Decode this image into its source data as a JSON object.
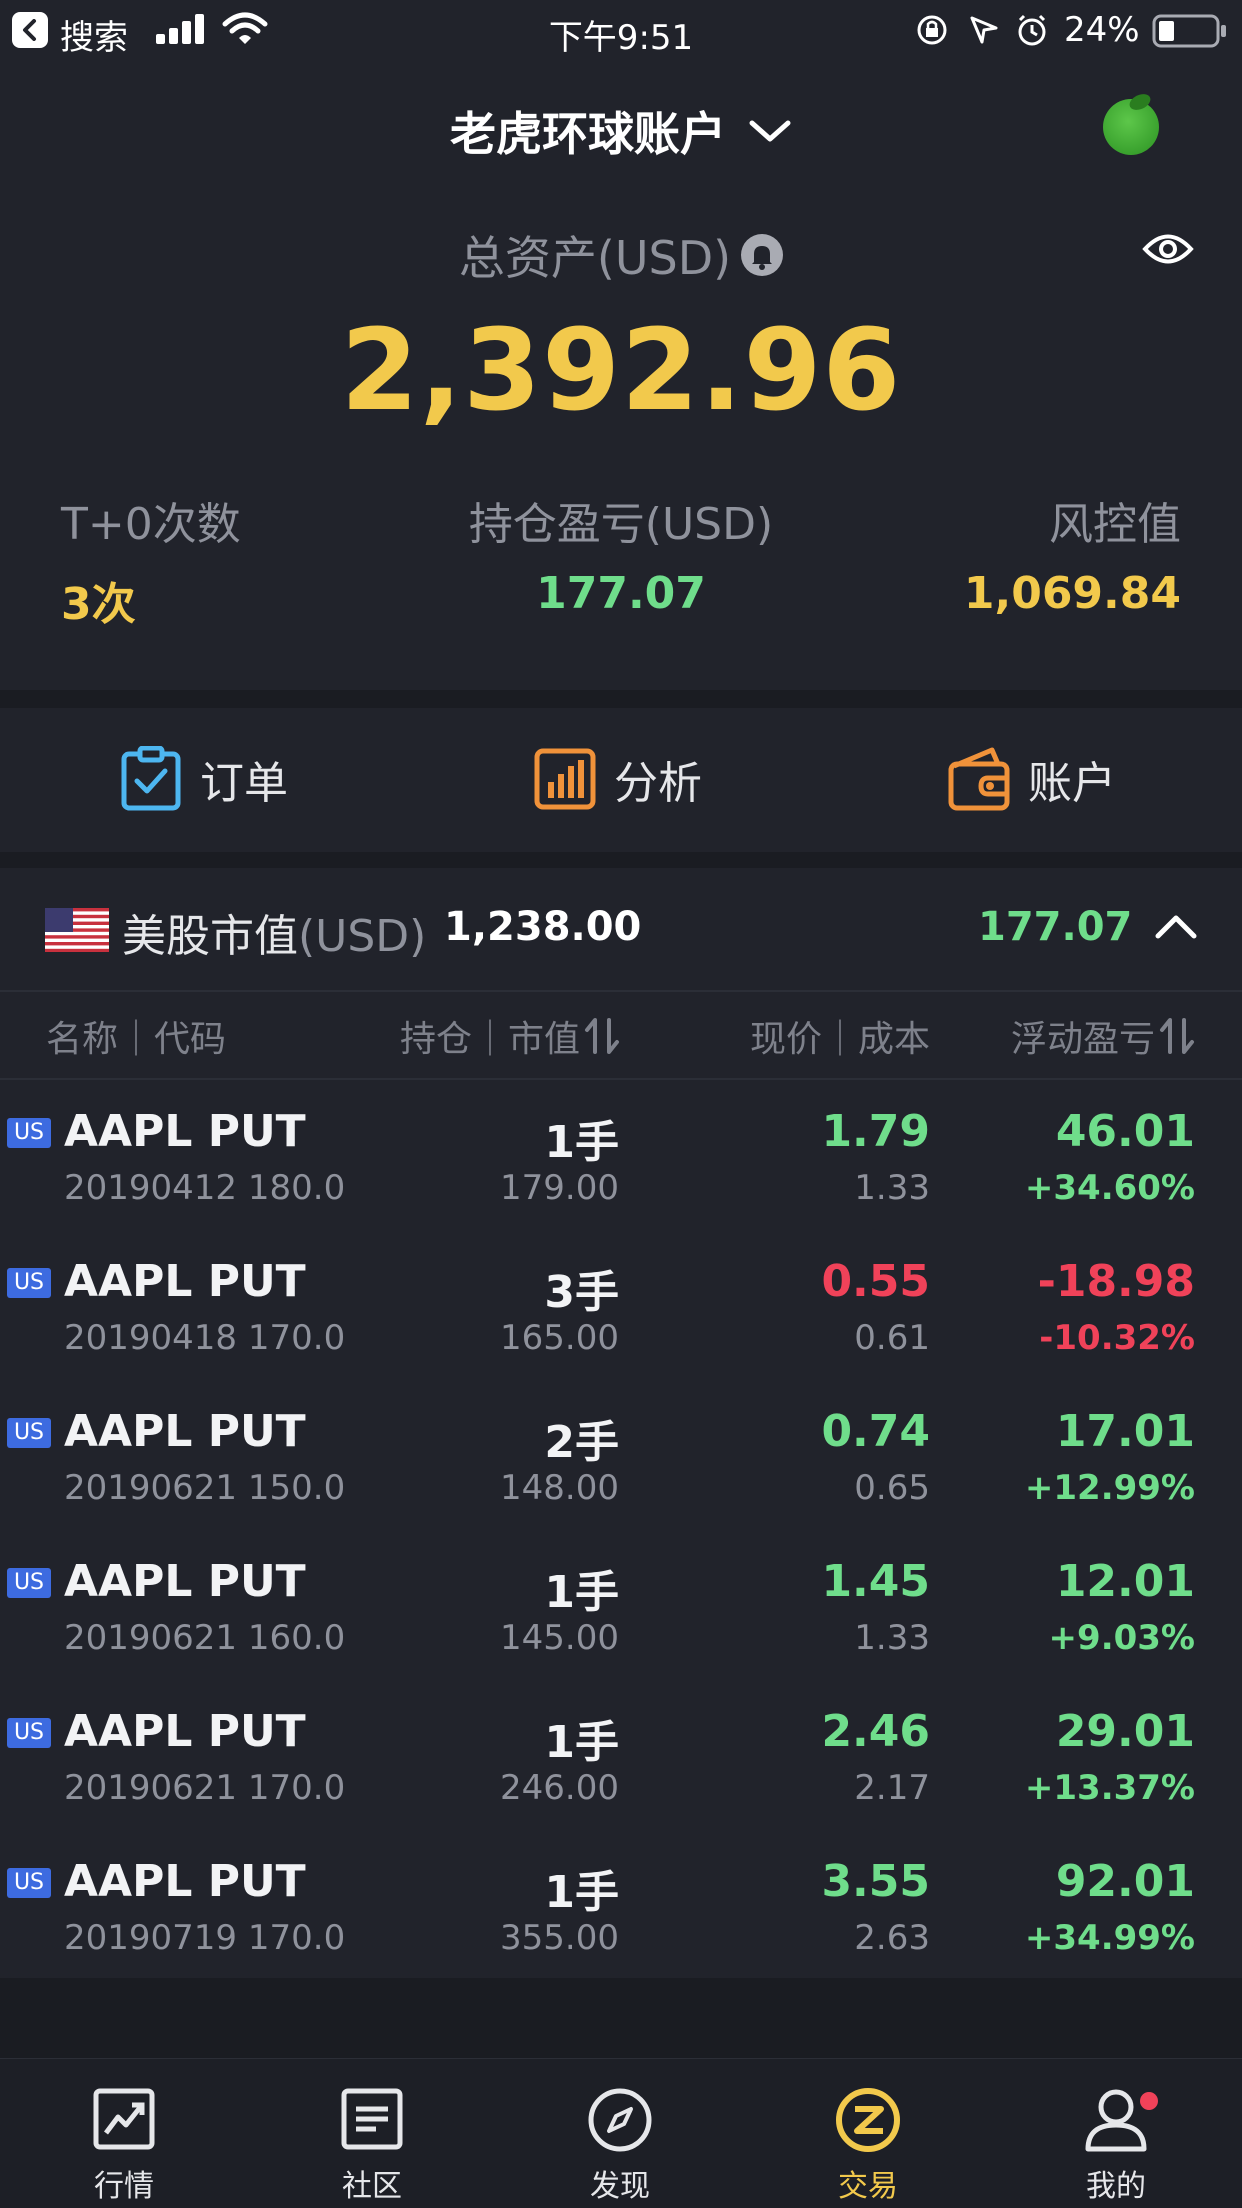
{
  "status_bar": {
    "back_label": "搜索",
    "time": "下午9:51",
    "battery_pct": "24%"
  },
  "account": {
    "title": "老虎环球账户",
    "total_label": "总资产(USD)",
    "total_value": "2,392.96"
  },
  "stats": [
    {
      "label": "T+0次数",
      "value": "3次",
      "color": "#f2c94c"
    },
    {
      "label": "持仓盈亏(USD)",
      "value": "177.07",
      "color": "#6fdd8b"
    },
    {
      "label": "风控值",
      "value": "1,069.84",
      "color": "#f2c94c"
    }
  ],
  "quick_actions": [
    {
      "label": "订单",
      "icon": "order-checklist-icon",
      "color": "#4db6f0"
    },
    {
      "label": "分析",
      "icon": "bar-chart-icon",
      "color": "#f0923a"
    },
    {
      "label": "账户",
      "icon": "wallet-icon",
      "color": "#f0923a"
    }
  ],
  "holdings": {
    "title": "美股市值",
    "unit": "(USD)",
    "market_value": "1,238.00",
    "pnl": "177.07",
    "columns": {
      "name": "名称｜代码",
      "position": "持仓｜市值",
      "price": "现价｜成本",
      "pnl": "浮动盈亏"
    },
    "badge": "US",
    "rows": [
      {
        "name": "AAPL PUT",
        "code": "20190412 180.0",
        "qty": "1手",
        "mv": "179.00",
        "price": "1.79",
        "cost": "1.33",
        "pnl": "46.01",
        "pct": "+34.60%",
        "dir": "up"
      },
      {
        "name": "AAPL PUT",
        "code": "20190418 170.0",
        "qty": "3手",
        "mv": "165.00",
        "price": "0.55",
        "cost": "0.61",
        "pnl": "-18.98",
        "pct": "-10.32%",
        "dir": "down"
      },
      {
        "name": "AAPL PUT",
        "code": "20190621 150.0",
        "qty": "2手",
        "mv": "148.00",
        "price": "0.74",
        "cost": "0.65",
        "pnl": "17.01",
        "pct": "+12.99%",
        "dir": "up"
      },
      {
        "name": "AAPL PUT",
        "code": "20190621 160.0",
        "qty": "1手",
        "mv": "145.00",
        "price": "1.45",
        "cost": "1.33",
        "pnl": "12.01",
        "pct": "+9.03%",
        "dir": "up"
      },
      {
        "name": "AAPL PUT",
        "code": "20190621 170.0",
        "qty": "1手",
        "mv": "246.00",
        "price": "2.46",
        "cost": "2.17",
        "pnl": "29.01",
        "pct": "+13.37%",
        "dir": "up"
      },
      {
        "name": "AAPL PUT",
        "code": "20190719 170.0",
        "qty": "1手",
        "mv": "355.00",
        "price": "3.55",
        "cost": "2.63",
        "pnl": "92.01",
        "pct": "+34.99%",
        "dir": "up"
      }
    ]
  },
  "tabs": [
    {
      "label": "行情",
      "icon": "market-chart-icon",
      "active": false
    },
    {
      "label": "社区",
      "icon": "community-list-icon",
      "active": false
    },
    {
      "label": "发现",
      "icon": "compass-icon",
      "active": false
    },
    {
      "label": "交易",
      "icon": "trade-z-icon",
      "active": true
    },
    {
      "label": "我的",
      "icon": "profile-icon",
      "active": false
    }
  ],
  "colors": {
    "accent": "#f2c94c",
    "up": "#6fdd8b",
    "down": "#f04259",
    "background": "#21232b"
  }
}
